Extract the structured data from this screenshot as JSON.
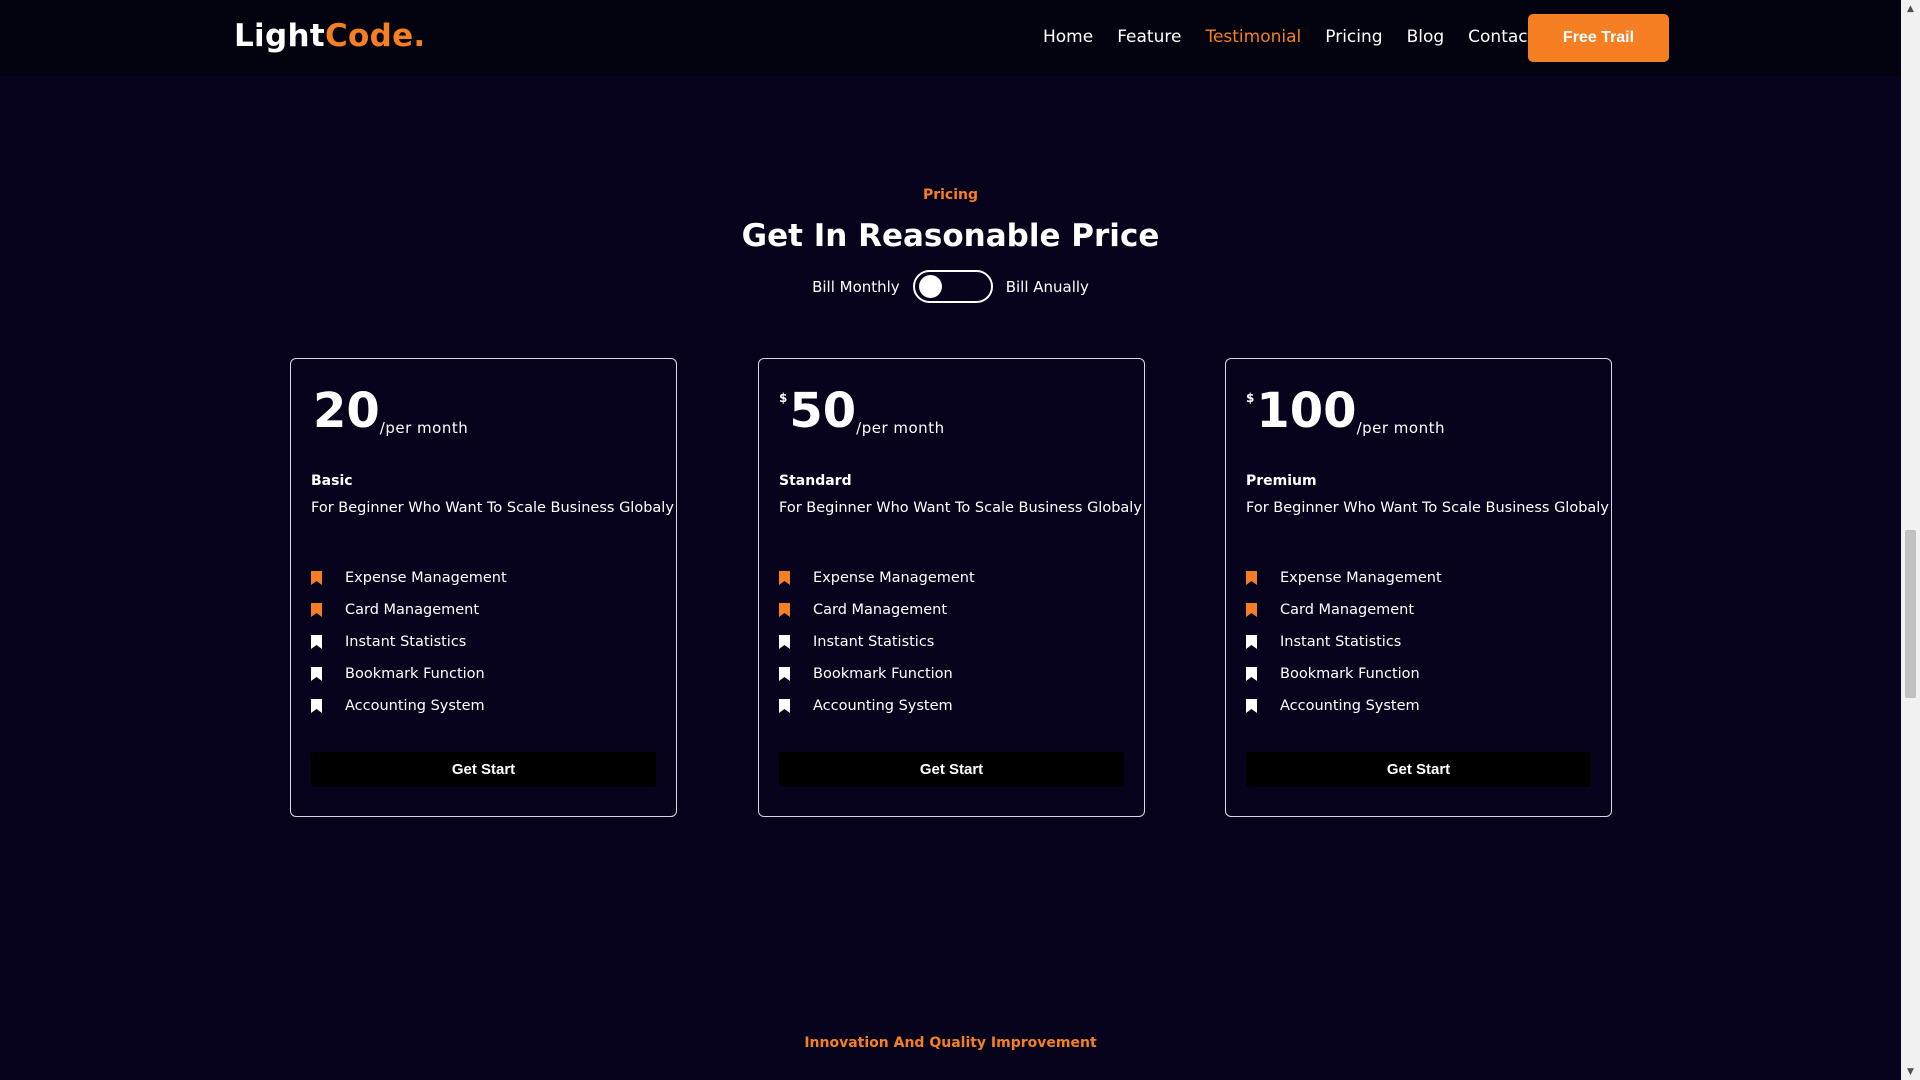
{
  "nav": {
    "logo_light": "Light",
    "logo_code": "Code.",
    "links": [
      "Home",
      "Feature",
      "Testimonial",
      "Pricing",
      "Blog",
      "Contact"
    ],
    "active_link": "Testimonial",
    "cta_label": "Free Trail"
  },
  "pricing": {
    "label": "Pricing",
    "title": "Get In Reasonable Price",
    "billing_monthly": "Bill Monthly",
    "billing_annually": "Bill Anually",
    "plans": [
      {
        "currency": "",
        "amount": "20",
        "period": "/per month",
        "name": "Basic",
        "description": "For Beginner Who Want To Scale Business Globaly",
        "features": [
          "Expense Management",
          "Card Management",
          "Instant Statistics",
          "Bookmark Function",
          "Accounting System"
        ],
        "button": "Get Start"
      },
      {
        "currency": "$",
        "amount": "50",
        "period": "/per month",
        "name": "Standard",
        "description": "For Beginner Who Want To Scale Business Globaly",
        "features": [
          "Expense Management",
          "Card Management",
          "Instant Statistics",
          "Bookmark Function",
          "Accounting System"
        ],
        "button": "Get Start"
      },
      {
        "currency": "$",
        "amount": "100",
        "period": "/per month",
        "name": "Premium",
        "description": "For Beginner Who Want To Scale Business Globaly",
        "features": [
          "Expense Management",
          "Card Management",
          "Instant Statistics",
          "Bookmark Function",
          "Accounting System"
        ],
        "button": "Get Start"
      }
    ]
  },
  "next_section": {
    "label": "Innovation And Quality Improvement"
  },
  "colors": {
    "accent": "#f57f22",
    "background": "#07031c",
    "navbar": "#03020f"
  },
  "icons": {
    "feature_bullet": "bookmark-icon"
  }
}
